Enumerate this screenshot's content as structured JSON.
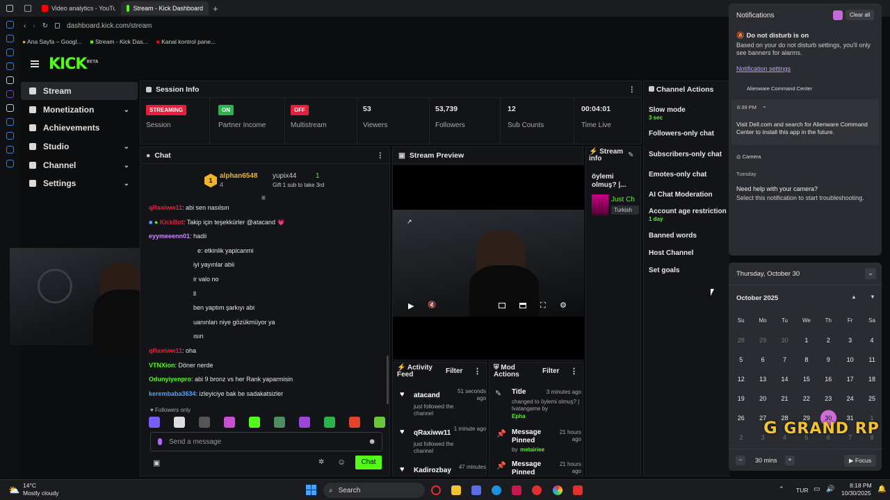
{
  "browser": {
    "tabs": [
      {
        "label": "Video analytics - YouTube",
        "icon": "youtube-icon",
        "color": "#ff0000"
      },
      {
        "label": "Stream - Kick Dashboard",
        "icon": "kick-icon",
        "color": "#53fc18",
        "active": true
      }
    ],
    "url": "dashboard.kick.com/stream",
    "bookmarks": [
      {
        "label": "Ana Sayfa – Googl...",
        "icon": "google-icon"
      },
      {
        "label": "Stream - Kick Das...",
        "icon": "kick-icon"
      },
      {
        "label": "Kanal kontrol pane...",
        "icon": "youtube-icon"
      }
    ]
  },
  "kick": {
    "logo": "KICK",
    "logo_sup": "BETA",
    "nav": [
      {
        "label": "Stream",
        "icon": "stream-icon",
        "active": true
      },
      {
        "label": "Monetization",
        "icon": "money-icon",
        "chevron": true
      },
      {
        "label": "Achievements",
        "icon": "trophy-icon"
      },
      {
        "label": "Studio",
        "icon": "studio-icon",
        "chevron": true
      },
      {
        "label": "Channel",
        "icon": "channel-icon",
        "chevron": true
      },
      {
        "label": "Settings",
        "icon": "gear-icon",
        "chevron": true
      }
    ],
    "session": {
      "title": "Session Info",
      "cells": [
        {
          "badge": "STREAMING",
          "badge_color": "#e91e3c",
          "label": "Session"
        },
        {
          "badge": "ON",
          "badge_color": "#2bb24c",
          "label": "Partner Income"
        },
        {
          "badge": "OFF",
          "badge_color": "#e91e3c",
          "label": "Multistream"
        },
        {
          "value": "53",
          "label": "Viewers"
        },
        {
          "value": "53,739",
          "label": "Followers"
        },
        {
          "value": "12",
          "label": "Sub Counts"
        },
        {
          "value": "00:04:01",
          "label": "Time Live"
        }
      ]
    },
    "chat": {
      "title": "Chat",
      "top_gifter": {
        "rank": "1",
        "name": "alphan6548",
        "count": "4",
        "other": "yupix44",
        "other_count": "1",
        "gift_note": "Gift 1 sub to take 3rd"
      },
      "messages": [
        {
          "user": "qRaxiww11",
          "color": "#e91e3c",
          "text": "abi sen nasılsın"
        },
        {
          "user": "KickBot",
          "color": "#e91e3c",
          "text": "Takip için teşekkürler @atacand 💗"
        },
        {
          "user": "eyymeeenn01",
          "color": "#c88cff",
          "text": "hadii"
        },
        {
          "user": "",
          "color": "#c88cff",
          "text": "e: etkinlik yapicanmi"
        },
        {
          "user": "",
          "color": "#fff",
          "text": "iyi yayınlar abii"
        },
        {
          "user": "",
          "color": "#fff",
          "text": "ir valo no"
        },
        {
          "user": "",
          "color": "#fff",
          "text": "ll"
        },
        {
          "user": "",
          "color": "#fff",
          "text": "ben yaptım şarkıyı abi"
        },
        {
          "user": "",
          "color": "#fff",
          "text": "uanınları niye gözükmüyor ya"
        },
        {
          "user": "",
          "color": "#fff",
          "text": "ısın"
        },
        {
          "user": "qRaxiww11",
          "color": "#e91e3c",
          "text": "oha"
        },
        {
          "user": "VTNXion",
          "color": "#53fc18",
          "text": "Döner nerde"
        },
        {
          "user": "Odunyiyenpro",
          "color": "#53fc18",
          "text": "abi 9 bronz vs her Rank yaparmisin"
        },
        {
          "user": "kerembaba3634",
          "color": "#4aa3ff",
          "text": "izleyiciye bak be sadakatsizler"
        }
      ],
      "followers_only": "Followers only",
      "placeholder": "Send a message",
      "send_label": "Chat"
    },
    "preview": {
      "title": "Stream Preview"
    },
    "stream_info": {
      "title": "Stream info",
      "stream_title": "öylemi olmuş? |...",
      "category": "Just Ch",
      "language": "Turkish"
    },
    "activity": {
      "title": "Activity Feed",
      "filter": "Filter",
      "items": [
        {
          "name": "atacand",
          "sub": "just followed the channel",
          "time": "51 seconds ago"
        },
        {
          "name": "qRaxiww11",
          "sub": "just followed the channel",
          "time": "1 minute ago"
        },
        {
          "name": "Kadirozbay",
          "sub": "",
          "time": "47 minutes"
        }
      ]
    },
    "mod": {
      "title": "Mod Actions",
      "filter": "Filter",
      "items": [
        {
          "name": "Title",
          "sub": "changed to öylemi olmuş? | lvatangame by",
          "by": "Epha",
          "time": "3 minutes ago"
        },
        {
          "name": "Message Pinned",
          "sub": "by",
          "by": "metairiee",
          "time": "21 hours ago"
        },
        {
          "name": "Message Pinned",
          "sub": "",
          "by": "",
          "time": "21 hours ago"
        }
      ]
    },
    "channel_actions": {
      "title": "Channel Actions",
      "items": [
        {
          "label": "Slow mode",
          "sub": "3 sec"
        },
        {
          "label": "Followers-only chat",
          "sub": ""
        },
        {
          "label": "Subscribers-only chat",
          "sub": ""
        },
        {
          "label": "Emotes-only chat",
          "sub": ""
        },
        {
          "label": "AI Chat Moderation",
          "sub": ""
        },
        {
          "label": "Account age restriction",
          "sub": "1 day"
        },
        {
          "label": "Banned words",
          "sub": ""
        },
        {
          "label": "Host Channel",
          "sub": ""
        },
        {
          "label": "Set goals",
          "sub": ""
        }
      ]
    }
  },
  "notifications": {
    "title": "Notifications",
    "clear_all": "Clear all",
    "dnd_title": "Do not disturb is on",
    "dnd_text": "Based on your do not disturb settings, you'll only see banners for alarms.",
    "settings_link": "Notification settings",
    "app1": "Alienware Command Center",
    "time1": "6:39 PM",
    "text1": "Visit Dell.com and search for Alienware Command Center to install this app in the future.",
    "app2": "Camera",
    "day2": "Tuesday",
    "text2_title": "Need help with your camera?",
    "text2": "Select this notification to start troubleshooting."
  },
  "calendar": {
    "date_header": "Thursday, October 30",
    "month": "October 2025",
    "weekdays": [
      "Su",
      "Mo",
      "Tu",
      "We",
      "Th",
      "Fr",
      "Sa"
    ],
    "days": [
      "28",
      "29",
      "30",
      "1",
      "2",
      "3",
      "4",
      "5",
      "6",
      "7",
      "8",
      "9",
      "10",
      "11",
      "12",
      "13",
      "14",
      "15",
      "16",
      "17",
      "18",
      "19",
      "20",
      "21",
      "22",
      "23",
      "24",
      "25",
      "26",
      "27",
      "28",
      "29",
      "30",
      "31",
      "1",
      "2",
      "3",
      "4",
      "5",
      "6",
      "7",
      "8"
    ],
    "today": "30",
    "focus_minutes": "30 mins",
    "focus_label": "Focus"
  },
  "watermark": "GRAND RP",
  "taskbar": {
    "weather_temp": "14°C",
    "weather_desc": "Mostly cloudy",
    "search": "Search",
    "lang": "TUR",
    "time": "8:18 PM",
    "date": "10/30/2025"
  }
}
